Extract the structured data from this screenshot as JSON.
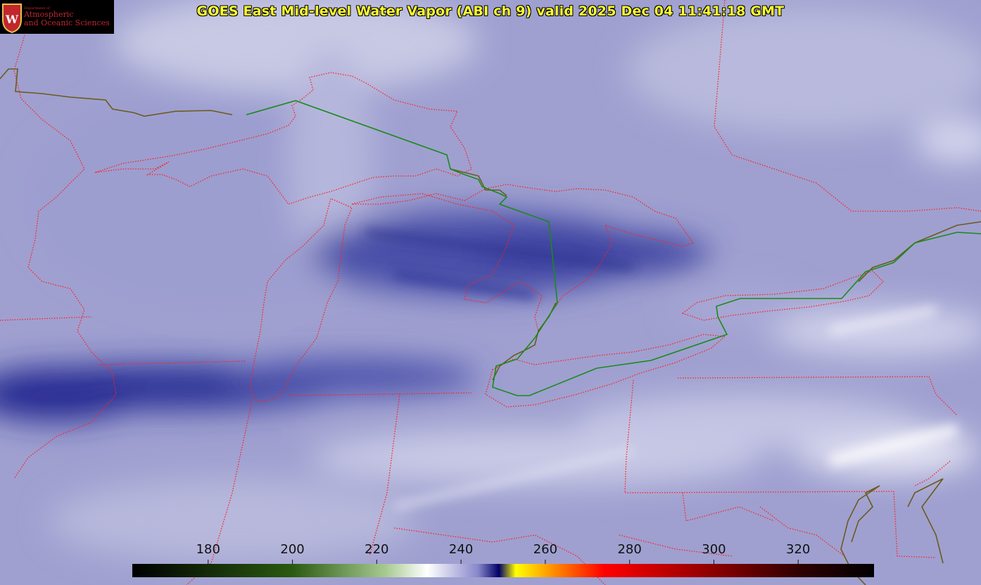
{
  "title": "GOES East Mid-level Water Vapor (ABI ch 9)  valid 2025 Dec 04 11:41:18 GMT",
  "logo": {
    "department_line": "Department of",
    "line1": "Atmospheric",
    "line2": "and Oceanic Sciences",
    "emblem_letter": "W"
  },
  "colorbar": {
    "ticks": [
      "180",
      "200",
      "220",
      "240",
      "260",
      "280",
      "300",
      "320"
    ],
    "value_range": [
      162,
      338
    ],
    "stops": [
      {
        "v": 162,
        "c": "#000000"
      },
      {
        "v": 200,
        "c": "#2a5a10"
      },
      {
        "v": 222,
        "c": "#a6c990"
      },
      {
        "v": 232,
        "c": "#ffffff"
      },
      {
        "v": 244,
        "c": "#8888cc"
      },
      {
        "v": 249,
        "c": "#000066"
      },
      {
        "v": 253,
        "c": "#ffff00"
      },
      {
        "v": 262,
        "c": "#ff8c00"
      },
      {
        "v": 274,
        "c": "#ff0000"
      },
      {
        "v": 300,
        "c": "#8b0000"
      },
      {
        "v": 320,
        "c": "#300000"
      },
      {
        "v": 338,
        "c": "#000000"
      }
    ]
  },
  "colors": {
    "background": "#9a9ccc",
    "state_border": "#ff2020",
    "international_border": "#1a8a1a",
    "coastline": "#6b5a1e",
    "title_text": "#ffff33"
  }
}
